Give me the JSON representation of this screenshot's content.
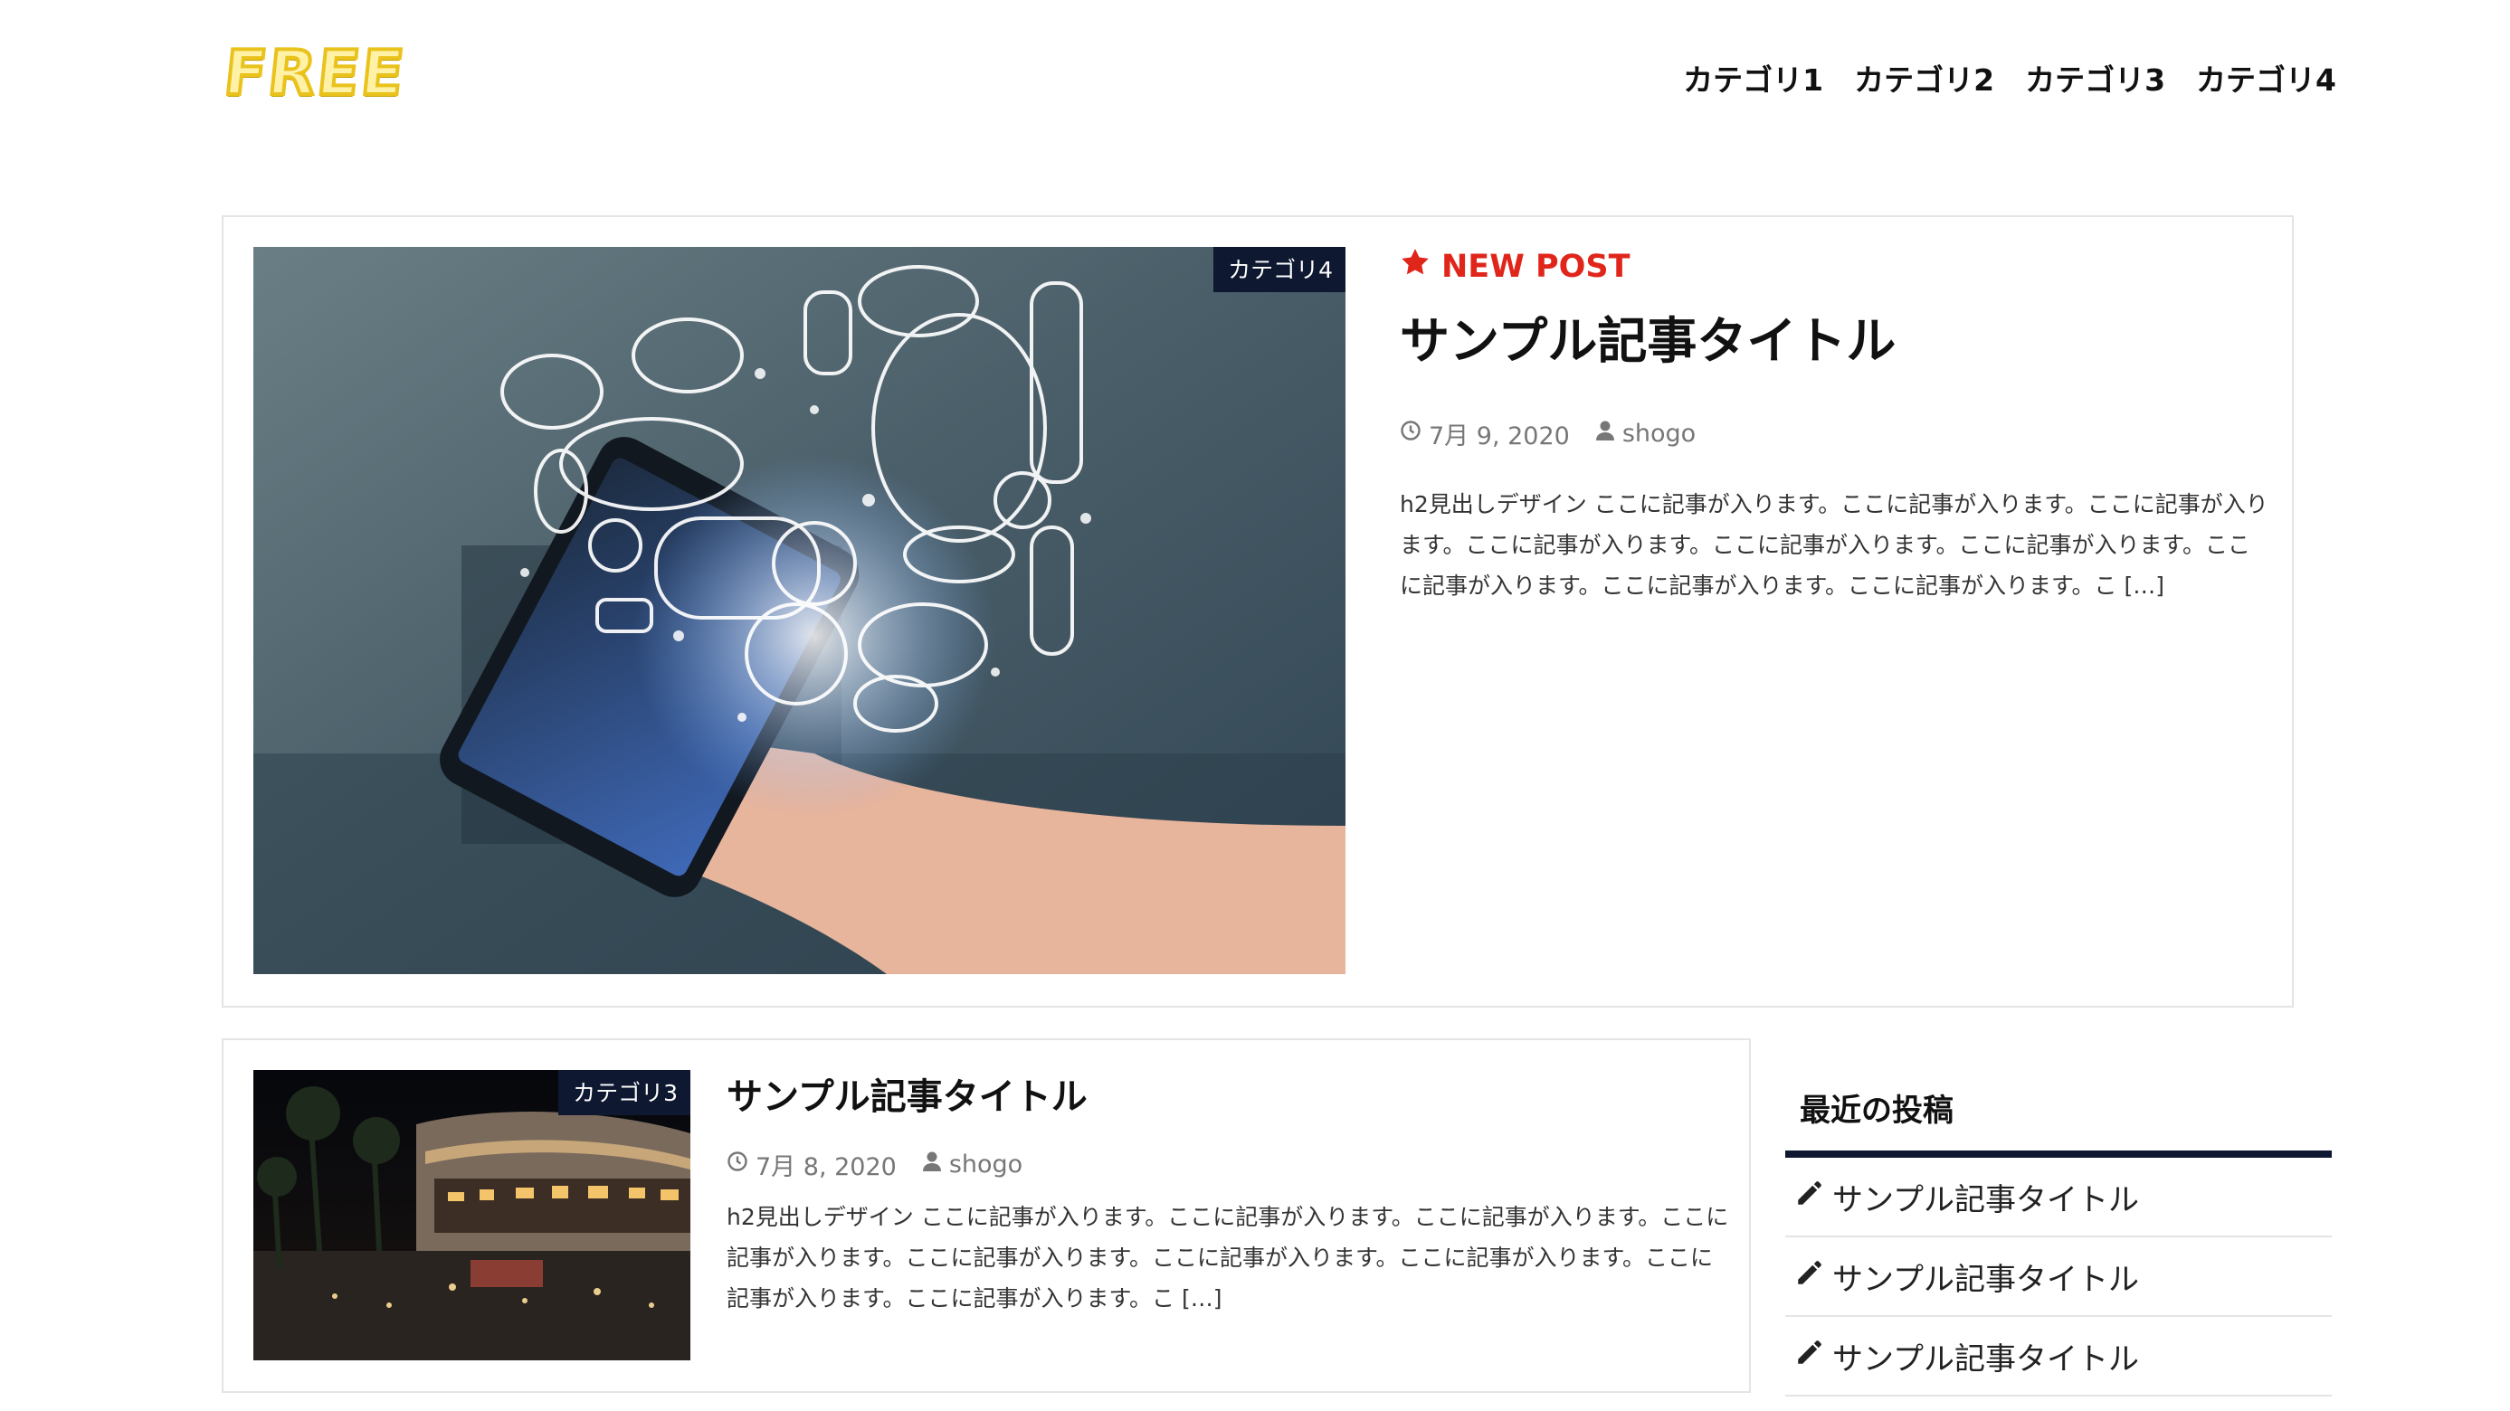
{
  "site": {
    "logo_text": "FREE"
  },
  "nav": {
    "items": [
      "カテゴリ1",
      "カテゴリ2",
      "カテゴリ3",
      "カテゴリ4"
    ]
  },
  "featured": {
    "category": "カテゴリ4",
    "badge": "NEW POST",
    "title": "サンプル記事タイトル",
    "date": "7月 9, 2020",
    "author": "shogo",
    "excerpt": "h2見出しデザイン ここに記事が入ります。ここに記事が入ります。ここに記事が入ります。ここに記事が入ります。ここに記事が入ります。ここに記事が入ります。ここに記事が入ります。ここに記事が入ります。ここに記事が入ります。こ […]"
  },
  "post2": {
    "category": "カテゴリ3",
    "title": "サンプル記事タイトル",
    "date": "7月 8, 2020",
    "author": "shogo",
    "excerpt": "h2見出しデザイン ここに記事が入ります。ここに記事が入ります。ここに記事が入ります。ここに記事が入ります。ここに記事が入ります。ここに記事が入ります。ここに記事が入ります。ここに記事が入ります。ここに記事が入ります。こ […]"
  },
  "sidebar": {
    "widget_title": "最近の投稿",
    "recent": [
      "サンプル記事タイトル",
      "サンプル記事タイトル",
      "サンプル記事タイトル"
    ]
  },
  "colors": {
    "accent_red": "#e0261b",
    "navy": "#0e1830",
    "logo_gold": "#e9c21c"
  },
  "icons": {
    "star": "star-icon",
    "clock": "clock-icon",
    "user": "user-icon",
    "pencil": "pencil-icon"
  }
}
